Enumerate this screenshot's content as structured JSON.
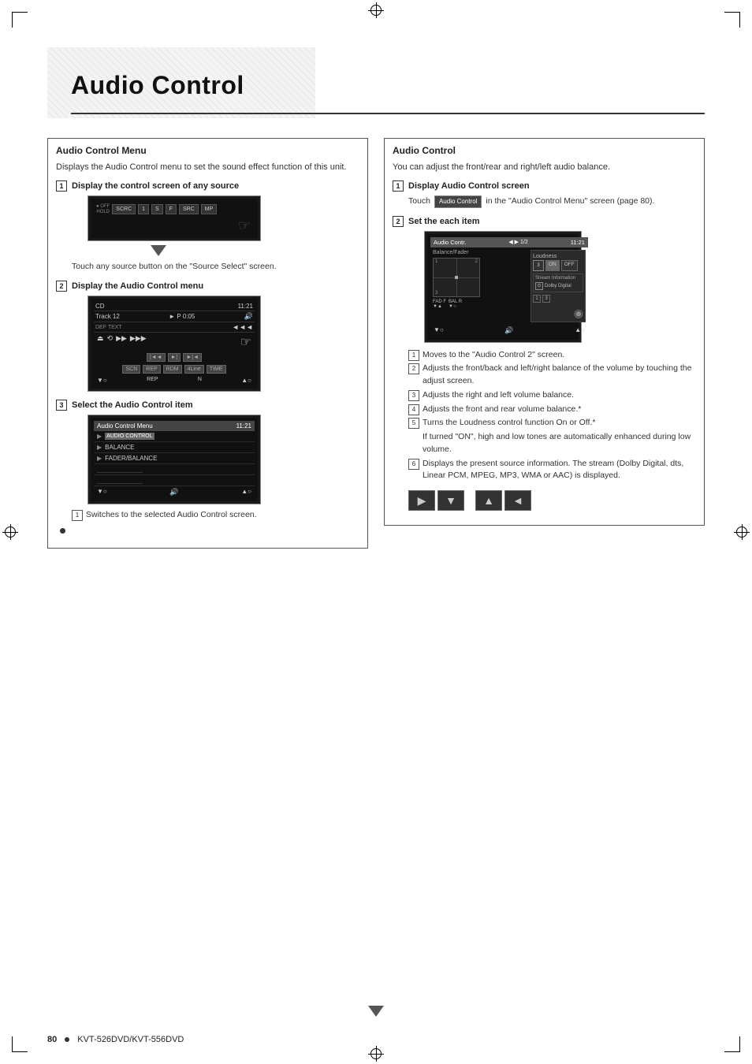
{
  "page": {
    "title": "Audio Control",
    "footer_page": "80",
    "footer_model": "KVT-526DVD/KVT-556DVD"
  },
  "left_section": {
    "title": "Audio Control Menu",
    "desc": "Displays the Audio Control menu to set the sound effect function of this unit.",
    "steps": [
      {
        "num": "1",
        "title": "Display the control screen of any source",
        "content": "Touch any source button on the \"Source Select\" screen."
      },
      {
        "num": "2",
        "title": "Display the Audio Control menu",
        "content": ""
      },
      {
        "num": "3",
        "title": "Select the Audio Control item",
        "content": ""
      }
    ],
    "step3_note": "Switches to the selected Audio Control screen."
  },
  "right_section": {
    "title": "Audio Control",
    "desc": "You can adjust the front/rear and right/left audio balance.",
    "steps": [
      {
        "num": "1",
        "title": "Display Audio Control screen",
        "content": "Touch",
        "button_label": "Audio Control",
        "content2": "in the \"Audio Control Menu\" screen (page 80)."
      },
      {
        "num": "2",
        "title": "Set the each item",
        "content": ""
      }
    ],
    "numbered_items": [
      {
        "num": "1",
        "text": "Moves to the \"Audio Control 2\" screen."
      },
      {
        "num": "2",
        "text": "Adjusts the front/back and left/right balance of the volume by touching the adjust screen."
      },
      {
        "num": "3",
        "text": "Adjusts the right and left volume balance."
      },
      {
        "num": "4",
        "text": "Adjusts the front and rear volume balance.*"
      },
      {
        "num": "5",
        "text": "Turns the Loudness control function On or Off.*"
      },
      {
        "num": "5_note",
        "text": "If turned \"ON\", high and low tones are automatically enhanced during low volume."
      },
      {
        "num": "6",
        "text": "Displays the present source information. The stream (Dolby Digital, dts, Linear PCM, MPEG, MP3, WMA or AAC) is displayed."
      }
    ]
  },
  "cd_screen": {
    "source": "CD",
    "track": "Track",
    "track_num": "12",
    "time": "0:05",
    "p_label": "P"
  },
  "ac_menu": {
    "title": "Audio Control Menu",
    "time": "11:21",
    "items": [
      "AUDIO CONTROL",
      "BALANCE",
      "FADER/BALANCE"
    ]
  },
  "ac_screen": {
    "title": "Audio Contr.",
    "time": "11:21",
    "loudness_label": "Loudness",
    "on_label": "ON",
    "off_label": "OFF",
    "stream_label": "Stream Information",
    "dolby_label": "Dolby Digital",
    "fad_label": "FAD F",
    "bal_label": "BAL R"
  }
}
